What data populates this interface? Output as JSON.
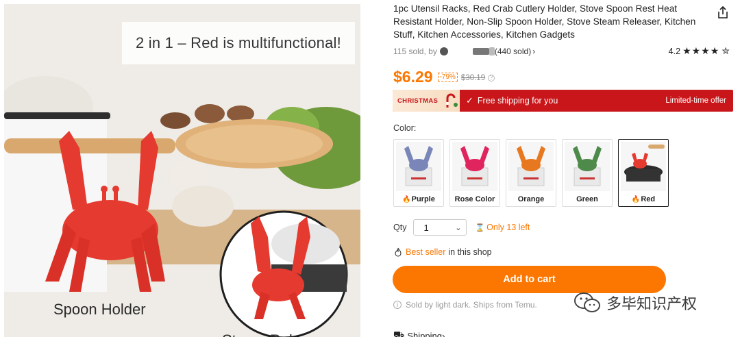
{
  "hero": {
    "headline": "2 in 1 – Red is multifunctional!",
    "caption_left": "Spoon Holder",
    "caption_bottom": "Steam Rele..."
  },
  "product": {
    "title": "1pc Utensil Racks, Red Crab Cutlery Holder, Stove Spoon Rest Heat Resistant Holder, Non-Slip Spoon Holder, Stove Steam Releaser, Kitchen Stuff, Kitchen Accessories, Kitchen Gadgets",
    "sold_text": "115 sold, by",
    "seller_sold": "(440 sold)",
    "rating": "4.2",
    "stars": "★★★★",
    "half_star": "✮",
    "price": "$6.29",
    "discount": "-79%",
    "old_price": "$30.19"
  },
  "promo": {
    "christmas_label": "CHRISTMAS",
    "free_shipping": "Free shipping for you",
    "limited": "Limited-time offer"
  },
  "color": {
    "label": "Color:",
    "options": [
      {
        "name": "Purple",
        "hot": true,
        "tint": "#7a86b8"
      },
      {
        "name": "Rose Color",
        "hot": false,
        "tint": "#e0245e"
      },
      {
        "name": "Orange",
        "hot": false,
        "tint": "#e8781f"
      },
      {
        "name": "Green",
        "hot": false,
        "tint": "#4e8a4a"
      },
      {
        "name": "Red",
        "hot": true,
        "tint": "#e53a2f"
      }
    ]
  },
  "quantity": {
    "label": "Qty",
    "value": "1",
    "stock": "Only 13 left"
  },
  "best_seller": {
    "highlight": "Best seller",
    "rest": "in this shop"
  },
  "add_to_cart": "Add to cart",
  "sold_by": "Sold by light dark. Ships from Temu.",
  "shipping": "Shipping",
  "watermark": "多毕知识产权",
  "colors": {
    "accent": "#fb7701",
    "promo_red": "#c8161a",
    "crab_red": "#e53a2f"
  }
}
